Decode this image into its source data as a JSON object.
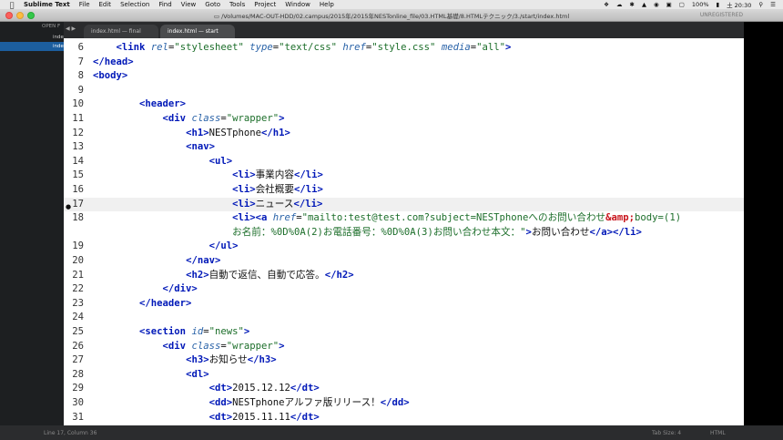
{
  "menubar": {
    "app": "Sublime Text",
    "menus": [
      "File",
      "Edit",
      "Selection",
      "Find",
      "View",
      "Goto",
      "Tools",
      "Project",
      "Window",
      "Help"
    ],
    "battery": "100%",
    "date": "土 20:30"
  },
  "window": {
    "title_path": "/Volumes/MAC-OUT-HDD/02.campus/2015年/2015年NESTonline_file/03.HTML基礎/8.HTMLテクニック/3./start/index.html",
    "unregistered": "UNREGISTERED"
  },
  "sidebar": {
    "heading": "OPEN F",
    "files": [
      "inde",
      "inde"
    ]
  },
  "tabs": [
    {
      "label": "index.html — final",
      "active": false
    },
    {
      "label": "index.html — start",
      "active": true
    }
  ],
  "editor": {
    "lines": [
      {
        "no": "6",
        "tokens": [
          [
            "txt",
            "    "
          ],
          [
            "tag",
            "<link"
          ],
          [
            "txt",
            " "
          ],
          [
            "attr",
            "rel"
          ],
          [
            "txt",
            "="
          ],
          [
            "str",
            "\"stylesheet\""
          ],
          [
            "txt",
            " "
          ],
          [
            "attr",
            "type"
          ],
          [
            "txt",
            "="
          ],
          [
            "str",
            "\"text/css\""
          ],
          [
            "txt",
            " "
          ],
          [
            "attr",
            "href"
          ],
          [
            "txt",
            "="
          ],
          [
            "str",
            "\"style.css\""
          ],
          [
            "txt",
            " "
          ],
          [
            "attr",
            "media"
          ],
          [
            "txt",
            "="
          ],
          [
            "str",
            "\"all\""
          ],
          [
            "tag",
            ">"
          ]
        ]
      },
      {
        "no": "7",
        "tokens": [
          [
            "tag",
            "</head>"
          ]
        ]
      },
      {
        "no": "8",
        "tokens": [
          [
            "tag",
            "<body>"
          ]
        ]
      },
      {
        "no": "9",
        "tokens": []
      },
      {
        "no": "10",
        "tokens": [
          [
            "txt",
            "        "
          ],
          [
            "tag",
            "<header>"
          ]
        ]
      },
      {
        "no": "11",
        "tokens": [
          [
            "txt",
            "            "
          ],
          [
            "tag",
            "<div"
          ],
          [
            "txt",
            " "
          ],
          [
            "attr",
            "class"
          ],
          [
            "txt",
            "="
          ],
          [
            "str",
            "\"wrapper\""
          ],
          [
            "tag",
            ">"
          ]
        ]
      },
      {
        "no": "12",
        "tokens": [
          [
            "txt",
            "                "
          ],
          [
            "tag",
            "<h1>"
          ],
          [
            "txt",
            "NESTphone"
          ],
          [
            "tag",
            "</h1>"
          ]
        ]
      },
      {
        "no": "13",
        "tokens": [
          [
            "txt",
            "                "
          ],
          [
            "tag",
            "<nav>"
          ]
        ]
      },
      {
        "no": "14",
        "tokens": [
          [
            "txt",
            "                    "
          ],
          [
            "tag",
            "<ul>"
          ]
        ]
      },
      {
        "no": "15",
        "tokens": [
          [
            "txt",
            "                        "
          ],
          [
            "tag",
            "<li>"
          ],
          [
            "txt",
            "事業内容"
          ],
          [
            "tag",
            "</li>"
          ]
        ]
      },
      {
        "no": "16",
        "tokens": [
          [
            "txt",
            "                        "
          ],
          [
            "tag",
            "<li>"
          ],
          [
            "txt",
            "会社概要"
          ],
          [
            "tag",
            "</li>"
          ]
        ]
      },
      {
        "no": "17",
        "current": true,
        "tokens": [
          [
            "txt",
            "                        "
          ],
          [
            "tag",
            "<li>"
          ],
          [
            "txt",
            "ニュース"
          ],
          [
            "tag",
            "</li>"
          ]
        ]
      },
      {
        "no": "18",
        "tokens": [
          [
            "txt",
            "                        "
          ],
          [
            "tag",
            "<li><a"
          ],
          [
            "txt",
            " "
          ],
          [
            "attr",
            "href"
          ],
          [
            "txt",
            "="
          ],
          [
            "str",
            "\"mailto:test@test.com?subject=NESTphoneへのお問い合わせ"
          ],
          [
            "ent",
            "&amp;"
          ],
          [
            "str",
            "body=(1)"
          ]
        ]
      },
      {
        "no": "",
        "tokens": [
          [
            "txt",
            "                        "
          ],
          [
            "str",
            "お名前：%0D%0A(2)お電話番号：%0D%0A(3)お問い合わせ本文：\""
          ],
          [
            "tag",
            ">"
          ],
          [
            "txt",
            "お問い合わせ"
          ],
          [
            "tag",
            "</a></li>"
          ]
        ]
      },
      {
        "no": "19",
        "tokens": [
          [
            "txt",
            "                    "
          ],
          [
            "tag",
            "</ul>"
          ]
        ]
      },
      {
        "no": "20",
        "tokens": [
          [
            "txt",
            "                "
          ],
          [
            "tag",
            "</nav>"
          ]
        ]
      },
      {
        "no": "21",
        "tokens": [
          [
            "txt",
            "                "
          ],
          [
            "tag",
            "<h2>"
          ],
          [
            "txt",
            "自動で返信、自動で応答。"
          ],
          [
            "tag",
            "</h2>"
          ]
        ]
      },
      {
        "no": "22",
        "tokens": [
          [
            "txt",
            "            "
          ],
          [
            "tag",
            "</div>"
          ]
        ]
      },
      {
        "no": "23",
        "tokens": [
          [
            "txt",
            "        "
          ],
          [
            "tag",
            "</header>"
          ]
        ]
      },
      {
        "no": "24",
        "tokens": []
      },
      {
        "no": "25",
        "tokens": [
          [
            "txt",
            "        "
          ],
          [
            "tag",
            "<section"
          ],
          [
            "txt",
            " "
          ],
          [
            "attr",
            "id"
          ],
          [
            "txt",
            "="
          ],
          [
            "str",
            "\"news\""
          ],
          [
            "tag",
            ">"
          ]
        ]
      },
      {
        "no": "26",
        "tokens": [
          [
            "txt",
            "            "
          ],
          [
            "tag",
            "<div"
          ],
          [
            "txt",
            " "
          ],
          [
            "attr",
            "class"
          ],
          [
            "txt",
            "="
          ],
          [
            "str",
            "\"wrapper\""
          ],
          [
            "tag",
            ">"
          ]
        ]
      },
      {
        "no": "27",
        "tokens": [
          [
            "txt",
            "                "
          ],
          [
            "tag",
            "<h3>"
          ],
          [
            "txt",
            "お知らせ"
          ],
          [
            "tag",
            "</h3>"
          ]
        ]
      },
      {
        "no": "28",
        "tokens": [
          [
            "txt",
            "                "
          ],
          [
            "tag",
            "<dl>"
          ]
        ]
      },
      {
        "no": "29",
        "tokens": [
          [
            "txt",
            "                    "
          ],
          [
            "tag",
            "<dt>"
          ],
          [
            "txt",
            "2015.12.12"
          ],
          [
            "tag",
            "</dt>"
          ]
        ]
      },
      {
        "no": "30",
        "tokens": [
          [
            "txt",
            "                    "
          ],
          [
            "tag",
            "<dd>"
          ],
          [
            "txt",
            "NESTphoneアルファ版リリース！"
          ],
          [
            "tag",
            "</dd>"
          ]
        ]
      },
      {
        "no": "31",
        "tokens": [
          [
            "txt",
            "                    "
          ],
          [
            "tag",
            "<dt>"
          ],
          [
            "txt",
            "2015.11.11"
          ],
          [
            "tag",
            "</dt>"
          ]
        ]
      }
    ]
  },
  "status": {
    "position": "Line 17, Column 36",
    "tab_size": "Tab Size: 4",
    "syntax": "HTML"
  }
}
